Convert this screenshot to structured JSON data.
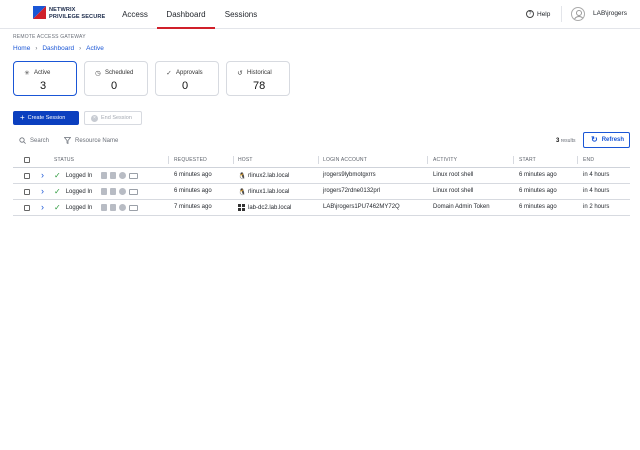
{
  "brand": {
    "line1": "NETWRIX",
    "line2": "PRIVILEGE SECURE",
    "colors": [
      "#1a56d6",
      "#d0202a"
    ]
  },
  "nav": [
    {
      "label": "Access",
      "active": false
    },
    {
      "label": "Dashboard",
      "active": true
    },
    {
      "label": "Sessions",
      "active": false
    }
  ],
  "header": {
    "help_label": "Help",
    "username": "LAB\\jrogers"
  },
  "page": {
    "section_label": "REMOTE ACCESS GATEWAY"
  },
  "breadcrumb": [
    "Home",
    "Dashboard",
    "Active"
  ],
  "cards": [
    {
      "label": "Active",
      "count": "3",
      "icon": "sparkle-icon",
      "active": true
    },
    {
      "label": "Scheduled",
      "count": "0",
      "icon": "clock-icon",
      "active": false
    },
    {
      "label": "Approvals",
      "count": "0",
      "icon": "check-icon",
      "active": false
    },
    {
      "label": "Historical",
      "count": "78",
      "icon": "history-icon",
      "active": false
    }
  ],
  "toolbar": {
    "create_label": "Create Session",
    "end_label": "End Session"
  },
  "filters": {
    "search_label": "Search",
    "resource_label": "Resource Name"
  },
  "results": {
    "count": "3",
    "suffix": "results"
  },
  "refresh_label": "Refresh",
  "table": {
    "columns": [
      "STATUS",
      "REQUESTED",
      "HOST",
      "LOGIN ACCOUNT",
      "ACTIVITY",
      "START",
      "END"
    ],
    "rows": [
      {
        "status": "Logged In",
        "requested": "6 minutes ago",
        "host": "rlinux2.lab.local",
        "host_os": "linux",
        "login": "jrogers9lybmotgxrrs",
        "activity": "Linux root shell",
        "start": "6 minutes ago",
        "end": "in 4 hours"
      },
      {
        "status": "Logged In",
        "requested": "6 minutes ago",
        "host": "rlinux1.lab.local",
        "host_os": "linux",
        "login": "jrogers72rdne0132prl",
        "activity": "Linux root shell",
        "start": "6 minutes ago",
        "end": "in 4 hours"
      },
      {
        "status": "Logged In",
        "requested": "7 minutes ago",
        "host": "lab-dc2.lab.local",
        "host_os": "windows",
        "login": "LAB\\jrogers1PU7462MY72Q",
        "activity": "Domain Admin Token",
        "start": "6 minutes ago",
        "end": "in 2 hours"
      }
    ]
  }
}
